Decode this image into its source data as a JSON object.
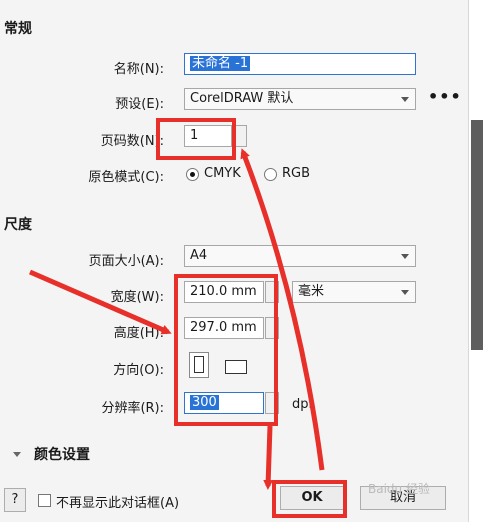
{
  "sections": {
    "general": "常规",
    "size": "尺度",
    "color_settings": "颜色设置"
  },
  "fields": {
    "name": {
      "label": "名称(N):",
      "value": "未命名 -1"
    },
    "preset": {
      "label": "预设(E):",
      "value": "CorelDRAW 默认"
    },
    "pages": {
      "label": "页码数(N):",
      "value": "1"
    },
    "color_mode": {
      "label": "原色模式(C):",
      "options": [
        "CMYK",
        "RGB"
      ],
      "selected": "CMYK"
    },
    "page_size": {
      "label": "页面大小(A):",
      "value": "A4"
    },
    "width": {
      "label": "宽度(W):",
      "value": "210.0 mm",
      "unit": "毫米"
    },
    "height": {
      "label": "高度(H):",
      "value": "297.0 mm"
    },
    "orientation": {
      "label": "方向(O):"
    },
    "resolution": {
      "label": "分辨率(R):",
      "value": "300",
      "unit": "dpi"
    }
  },
  "footer": {
    "help": "?",
    "dont_show": "不再显示此对话框(A)",
    "ok": "OK",
    "cancel": "取消"
  },
  "watermark": "Baidu 经验",
  "colors": {
    "annotation_red": "#e8302a",
    "selection_blue": "#2a73d6"
  }
}
